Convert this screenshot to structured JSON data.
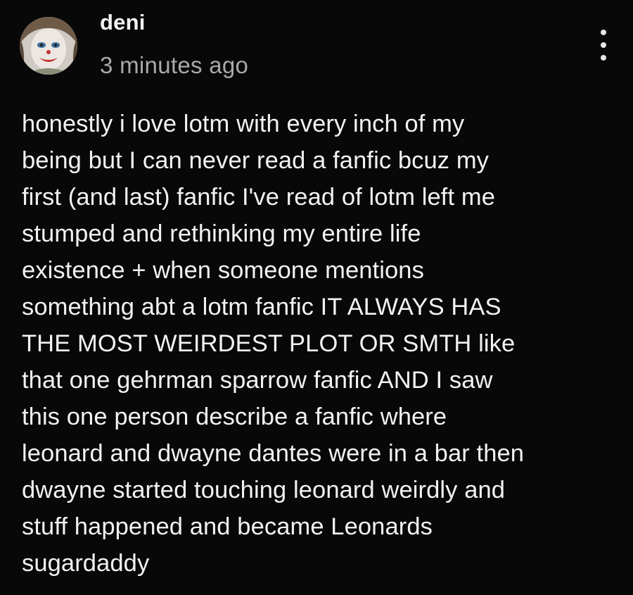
{
  "comment": {
    "author": "deni",
    "timestamp": "3 minutes ago",
    "avatar_icon": "clown-makeup-avatar",
    "more_icon": "more-vertical-icon",
    "body_lines": [
      "honestly i love lotm with every inch of my",
      "being but I can never read a fanfic bcuz my",
      "first (and last) fanfic I've read of lotm left me",
      "stumped and rethinking my entire life",
      "existence + when someone mentions",
      "something abt a lotm fanfic IT ALWAYS HAS",
      "THE MOST WEIRDEST PLOT OR SMTH like",
      "that one gehrman sparrow fanfic AND I saw",
      "this one person describe a fanfic where",
      "leonard and dwayne dantes were in a bar then",
      "dwayne started touching leonard weirdly and",
      "stuff happened and became Leonards",
      "sugardaddy"
    ]
  },
  "colors": {
    "background": "#080808",
    "text_primary": "#f2f2f2",
    "text_secondary": "#a9a9a9"
  }
}
